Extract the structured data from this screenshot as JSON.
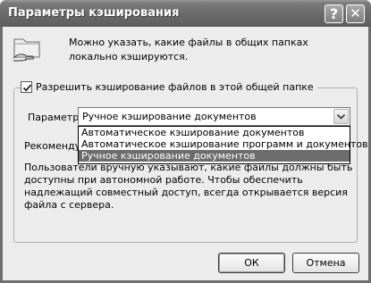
{
  "window": {
    "title": "Параметры кэширования",
    "help_glyph": "?",
    "close_glyph": "✕"
  },
  "intro_text": "Можно указать, какие файлы в общих папках локально кэшируются.",
  "allow_caching": {
    "label": "Разрешить кэширование файлов в этой общей папке",
    "checked": true
  },
  "setting": {
    "label": "Параметр:",
    "selected": "Ручное кэширование документов",
    "options": [
      "Автоматическое кэширование документов",
      "Автоматическое кэширование программ и документов",
      "Ручное кэширование документов"
    ]
  },
  "recommended_label": "Рекомендуется:",
  "description": "Пользователи вручную указывают, какие файлы должны быть доступны при автономной работе. Чтобы обеспечить надлежащий совместный доступ, всегда открывается версия файла с сервера.",
  "buttons": {
    "ok": "ОК",
    "cancel": "Отмена"
  }
}
